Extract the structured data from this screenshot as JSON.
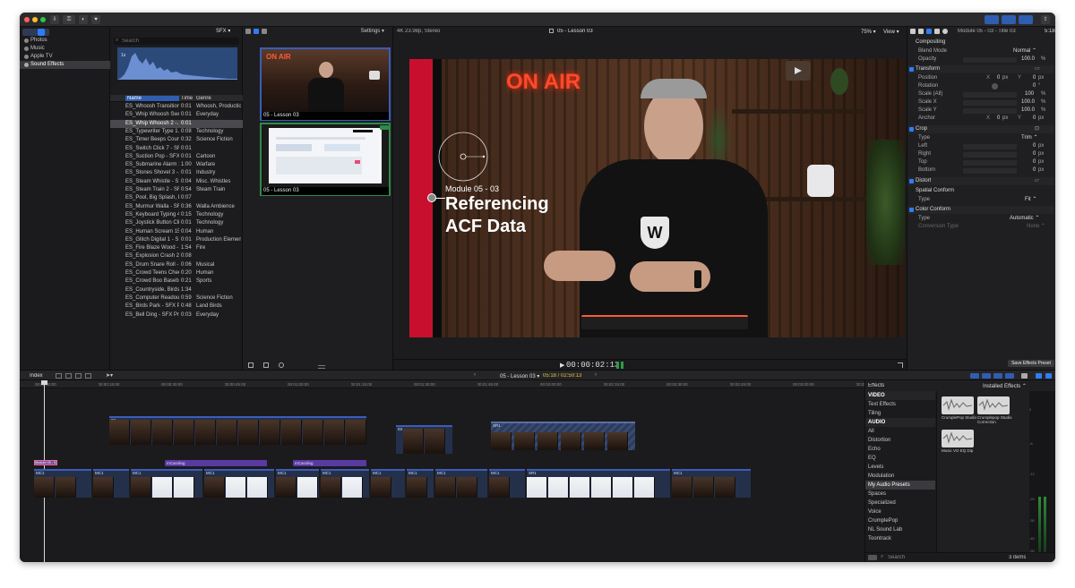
{
  "sidebar": {
    "items": [
      {
        "label": "Photos",
        "selected": false
      },
      {
        "label": "Music",
        "selected": false
      },
      {
        "label": "Apple TV",
        "selected": false
      },
      {
        "label": "Sound Effects",
        "selected": true
      }
    ]
  },
  "browser": {
    "category": "SFX",
    "search_placeholder": "Search",
    "columns": {
      "name": "Name",
      "time": "Time",
      "genre": "Genre"
    },
    "rows": [
      {
        "name": "ES_Whoosh Transition…",
        "time": "0:01",
        "genre": "Whoosh, Production E"
      },
      {
        "name": "ES_Whip Whoosh Swo…",
        "time": "0:01",
        "genre": "Everyday"
      },
      {
        "name": "ES_Whip Whoosh 2 -…",
        "time": "0:01",
        "genre": ""
      },
      {
        "name": "ES_Typewriter Type 1…",
        "time": "0:08",
        "genre": "Technology"
      },
      {
        "name": "ES_Timer Beeps Coun…",
        "time": "0:32",
        "genre": "Science Fiction"
      },
      {
        "name": "ES_Switch Click 7 - SF…",
        "time": "0:01",
        "genre": ""
      },
      {
        "name": "ES_Suction Pop - SFX…",
        "time": "0:01",
        "genre": "Cartoon"
      },
      {
        "name": "ES_Submarine Alarm 1…",
        "time": "1:00",
        "genre": "Warfare"
      },
      {
        "name": "ES_Stones Shovel 3 -…",
        "time": "0:01",
        "genre": "Industry"
      },
      {
        "name": "ES_Steam Whistle - S…",
        "time": "0:04",
        "genre": "Misc. Whistles"
      },
      {
        "name": "ES_Steam Train 2 - SF…",
        "time": "0:54",
        "genre": "Steam Train"
      },
      {
        "name": "ES_Pool, Big Splash, D…",
        "time": "0:07",
        "genre": ""
      },
      {
        "name": "ES_Murmur Walla - SF…",
        "time": "0:36",
        "genre": "Walla Ambience"
      },
      {
        "name": "ES_Keyboard Typing 4…",
        "time": "0:15",
        "genre": "Technology"
      },
      {
        "name": "ES_Joystick Button Cli…",
        "time": "0:01",
        "genre": "Technology"
      },
      {
        "name": "ES_Human Scream 15…",
        "time": "0:04",
        "genre": "Human"
      },
      {
        "name": "ES_Glitch Digital 1 - S…",
        "time": "0:01",
        "genre": "Production Element"
      },
      {
        "name": "ES_Fire Blaze Wood -…",
        "time": "1:54",
        "genre": "Fire"
      },
      {
        "name": "ES_Explosion Crash 2…",
        "time": "0:08",
        "genre": ""
      },
      {
        "name": "ES_Drum Snare Roll -…",
        "time": "0:06",
        "genre": "Musical"
      },
      {
        "name": "ES_Crowd Teens Chee…",
        "time": "0:20",
        "genre": "Human"
      },
      {
        "name": "ES_Crowd Boo Baseba…",
        "time": "0:21",
        "genre": "Sports"
      },
      {
        "name": "ES_Countryside, Birds…",
        "time": "1:34",
        "genre": ""
      },
      {
        "name": "ES_Computer Readout…",
        "time": "0:59",
        "genre": "Science Fiction"
      },
      {
        "name": "ES_Birds Park - SFX P…",
        "time": "0:48",
        "genre": "Land Birds"
      },
      {
        "name": "ES_Bell Ding - SFX Pr…",
        "time": "0:03",
        "genre": "Everyday"
      }
    ]
  },
  "event_browser": {
    "settings_label": "Settings",
    "clips": [
      {
        "label": "05 - Lesson 03"
      },
      {
        "label": "05 - Lesson 03"
      }
    ]
  },
  "viewer": {
    "format": "4K 23.98p, Stereo",
    "project": "05 - Lesson 03",
    "zoom": "75%",
    "view_label": "View",
    "overlay": {
      "module": "Module 05 - 03",
      "title_line1": "Referencing",
      "title_line2": "ACF Data"
    },
    "sign": "ON AIR",
    "timecode": "00:00:02:13"
  },
  "inspector": {
    "title": "Module 05 - 03 - Title 03",
    "duration": "5:18",
    "sections": {
      "compositing": "Compositing",
      "transform": "Transform",
      "crop": "Crop",
      "distort": "Distort",
      "spatial": "Spatial Conform",
      "color": "Color Conform"
    },
    "props": {
      "blend_mode": {
        "label": "Blend Mode",
        "value": "Normal"
      },
      "opacity": {
        "label": "Opacity",
        "value": "100.0",
        "unit": "%"
      },
      "position": {
        "label": "Position",
        "x": "0",
        "y": "0",
        "unit": "px",
        "x_label": "X",
        "y_label": "Y"
      },
      "rotation": {
        "label": "Rotation",
        "value": "0",
        "unit": "°"
      },
      "scale_all": {
        "label": "Scale (All)",
        "value": "100",
        "unit": "%"
      },
      "scale_x": {
        "label": "Scale X",
        "value": "100.0",
        "unit": "%"
      },
      "scale_y": {
        "label": "Scale Y",
        "value": "100.0",
        "unit": "%"
      },
      "anchor": {
        "label": "Anchor",
        "x": "0",
        "y": "0",
        "unit": "px",
        "x_label": "X",
        "y_label": "Y"
      },
      "crop_type": {
        "label": "Type",
        "value": "Trim"
      },
      "left": {
        "label": "Left",
        "value": "0",
        "unit": "px"
      },
      "right": {
        "label": "Right",
        "value": "0",
        "unit": "px"
      },
      "top": {
        "label": "Top",
        "value": "0",
        "unit": "px"
      },
      "bottom": {
        "label": "Bottom",
        "value": "0",
        "unit": "px"
      },
      "spatial_type": {
        "label": "Type",
        "value": "Fit"
      },
      "color_type": {
        "label": "Type",
        "value": "Automatic"
      },
      "conversion": {
        "label": "Conversion Type",
        "value": "None"
      }
    },
    "save_preset": "Save Effects Preset"
  },
  "timeline": {
    "index_label": "Index",
    "project": "05 - Lesson 03",
    "duration": "05:18 / 02:50:13",
    "ruler": [
      "00:00:00:00",
      "00:00:15:00",
      "00:00:30:00",
      "00:00:45:00",
      "00:01:00:00",
      "00:01:15:00",
      "00:01:30:00",
      "00:01:45:00",
      "00:02:00:00",
      "00:02:15:00",
      "00:02:30:00",
      "00:02:45:00",
      "00:03:00:00",
      "00:03:15:00"
    ],
    "clip_label": "MC1",
    "caption_label": "mCaroling",
    "title_clip_label": "Module 05 - 03",
    "connected_label": "03",
    "screen_label": "SR1"
  },
  "effects": {
    "title": "Effects",
    "filter": "Installed Effects",
    "categories": [
      {
        "label": "VIDEO",
        "header": true
      },
      {
        "label": "Text Effects",
        "header": false
      },
      {
        "label": "Tiling",
        "header": false
      },
      {
        "label": "AUDIO",
        "header": true
      },
      {
        "label": "All",
        "header": false
      },
      {
        "label": "Distortion",
        "header": false
      },
      {
        "label": "Echo",
        "header": false
      },
      {
        "label": "EQ",
        "header": false
      },
      {
        "label": "Levels",
        "header": false
      },
      {
        "label": "Modulation",
        "header": false
      },
      {
        "label": "My Audio Presets",
        "header": false,
        "selected": true
      },
      {
        "label": "Spaces",
        "header": false
      },
      {
        "label": "Specialized",
        "header": false
      },
      {
        "label": "Voice",
        "header": false
      },
      {
        "label": "CrumplePop",
        "header": false
      },
      {
        "label": "NL Sound Lab",
        "header": false
      },
      {
        "label": "Toontrack",
        "header": false
      }
    ],
    "presets": [
      {
        "label": "CrumplePop Studio"
      },
      {
        "label": "Crumplepop Studio Correction"
      },
      {
        "label": "Music VO EQ Dip"
      }
    ],
    "search_placeholder": "Search",
    "count": "3 items",
    "meter_labels": [
      "0",
      "-6",
      "-12",
      "-20",
      "-30",
      "-40",
      "-50"
    ]
  },
  "colors": {
    "accent": "#2f7cf6",
    "clip_blue": "#3b5db8",
    "caption_purple": "#5a3aa0",
    "selection": "#4a4a4e",
    "title_stripe": "#c8102e"
  }
}
